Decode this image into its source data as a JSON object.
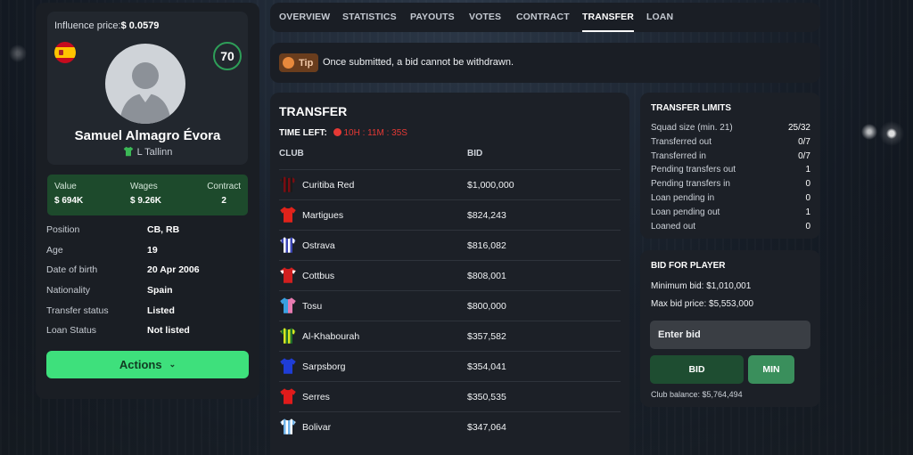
{
  "player": {
    "influence_label": "Influence price:",
    "influence_value": "$ 0.0579",
    "rating": "70",
    "name": "Samuel Almagro Évora",
    "club": "L Tallinn",
    "nationality_flag": "spain-flag-icon",
    "stats": {
      "value_label": "Value",
      "value": "$ 694K",
      "wages_label": "Wages",
      "wages": "$ 9.26K",
      "contract_label": "Contract",
      "contract": "2"
    },
    "details": [
      {
        "label": "Position",
        "value": "CB, RB"
      },
      {
        "label": "Age",
        "value": "19"
      },
      {
        "label": "Date of birth",
        "value": "20 Apr 2006"
      },
      {
        "label": "Nationality",
        "value": "Spain"
      },
      {
        "label": "Transfer status",
        "value": "Listed"
      },
      {
        "label": "Loan Status",
        "value": "Not listed"
      }
    ],
    "actions_label": "Actions"
  },
  "tabs": [
    "OVERVIEW",
    "STATISTICS",
    "PAYOUTS",
    "VOTES",
    "CONTRACT",
    "TRANSFER",
    "LOAN"
  ],
  "active_tab": "TRANSFER",
  "tip": {
    "badge": "Tip",
    "text": "Once submitted, a bid cannot be withdrawn."
  },
  "transfer": {
    "title": "TRANSFER",
    "time_left_label": "TIME LEFT:",
    "time_left": "10H : 11M : 35S",
    "col_club": "CLUB",
    "col_bid": "BID",
    "rows": [
      {
        "club": "Curitiba Red",
        "bid": "$1,000,000",
        "colors": [
          "#7a0c12",
          "#1a1a1a"
        ],
        "style": "stripes"
      },
      {
        "club": "Martigues",
        "bid": "$824,243",
        "colors": [
          "#e0231b",
          "#ffffff"
        ],
        "style": "solid"
      },
      {
        "club": "Ostrava",
        "bid": "$816,082",
        "colors": [
          "#ffffff",
          "#3b45b5"
        ],
        "style": "stripes"
      },
      {
        "club": "Cottbus",
        "bid": "$808,001",
        "colors": [
          "#d11f1f",
          "#ffffff"
        ],
        "style": "sleeves"
      },
      {
        "club": "Tosu",
        "bid": "$800,000",
        "colors": [
          "#3aa0e0",
          "#e77bb1"
        ],
        "style": "half"
      },
      {
        "club": "Al-Khabourah",
        "bid": "$357,582",
        "colors": [
          "#d6e620",
          "#1f6e2a"
        ],
        "style": "stripes"
      },
      {
        "club": "Sarpsborg",
        "bid": "$354,041",
        "colors": [
          "#1f3dd6",
          "#1f3dd6"
        ],
        "style": "solid"
      },
      {
        "club": "Serres",
        "bid": "$350,535",
        "colors": [
          "#e01b1b",
          "#e01b1b"
        ],
        "style": "solid"
      },
      {
        "club": "Bolivar",
        "bid": "$347,064",
        "colors": [
          "#6fb3ea",
          "#ffffff"
        ],
        "style": "stripes"
      }
    ]
  },
  "limits": {
    "title": "TRANSFER LIMITS",
    "rows": [
      {
        "label": "Squad size (min. 21)",
        "value": "25/32"
      },
      {
        "label": "Transferred out",
        "value": "0/7"
      },
      {
        "label": "Transferred in",
        "value": "0/7"
      },
      {
        "label": "Pending transfers out",
        "value": "1"
      },
      {
        "label": "Pending transfers in",
        "value": "0"
      },
      {
        "label": "Loan pending in",
        "value": "0"
      },
      {
        "label": "Loan pending out",
        "value": "1"
      },
      {
        "label": "Loaned out",
        "value": "0"
      }
    ]
  },
  "bid": {
    "title": "BID FOR PLAYER",
    "min_bid": "Minimum bid: $1,010,001",
    "max_bid": "Max bid price: $5,553,000",
    "placeholder": "Enter bid",
    "bid_label": "BID",
    "min_label": "MIN",
    "balance": "Club balance: $5,764,494"
  },
  "colors": {
    "accent_green": "#3ee07c",
    "dark_green": "#1d4a2c",
    "timer_red": "#e53935",
    "tip_orange": "#e8893c"
  }
}
